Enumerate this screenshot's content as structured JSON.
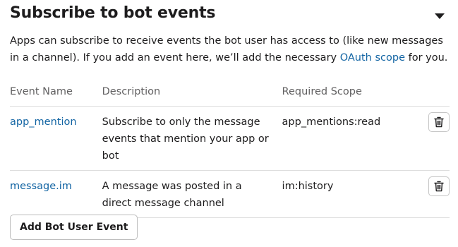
{
  "section": {
    "title": "Subscribe to bot events",
    "description_before": "Apps can subscribe to receive events the bot user has access to (like new messages in a channel). If you add an event here, we’ll add the necessary ",
    "description_link": "OAuth scope",
    "description_after": " for you."
  },
  "table": {
    "headers": {
      "name": "Event Name",
      "description": "Description",
      "scope": "Required Scope"
    },
    "rows": [
      {
        "name": "app_mention",
        "description": "Subscribe to only the message events that mention your app or bot",
        "scope": "app_mentions:read",
        "delete_icon": "trash-icon"
      },
      {
        "name": "message.im",
        "description": "A message was posted in a direct message channel",
        "scope": "im:history",
        "delete_icon": "trash-icon"
      }
    ]
  },
  "add_button_label": "Add Bot User Event",
  "colors": {
    "link": "#1264a3",
    "text": "#1d1c1d",
    "muted": "#616061",
    "divider": "#dddddd"
  }
}
